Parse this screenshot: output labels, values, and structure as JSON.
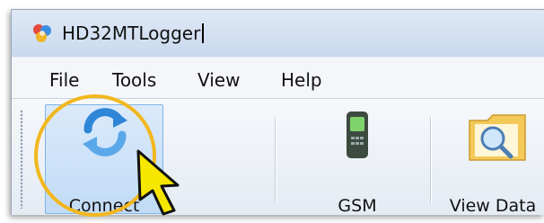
{
  "window": {
    "title": "HD32MTLogger"
  },
  "menu": [
    "File",
    "Tools",
    "View",
    "Help"
  ],
  "toolbar": {
    "connect_label": "Connect",
    "gsm_label": "GSM",
    "viewdata_label": "View Data"
  },
  "colors": {
    "callout_ring": "#f2b71f",
    "arrow_fill": "#f7e600",
    "selection_bg": "#c1dbf6"
  },
  "icons": [
    "app-logo-icon",
    "connect-refresh-icon",
    "gsm-phone-icon",
    "view-data-folder-icon",
    "pointer-arrow-icon"
  ]
}
